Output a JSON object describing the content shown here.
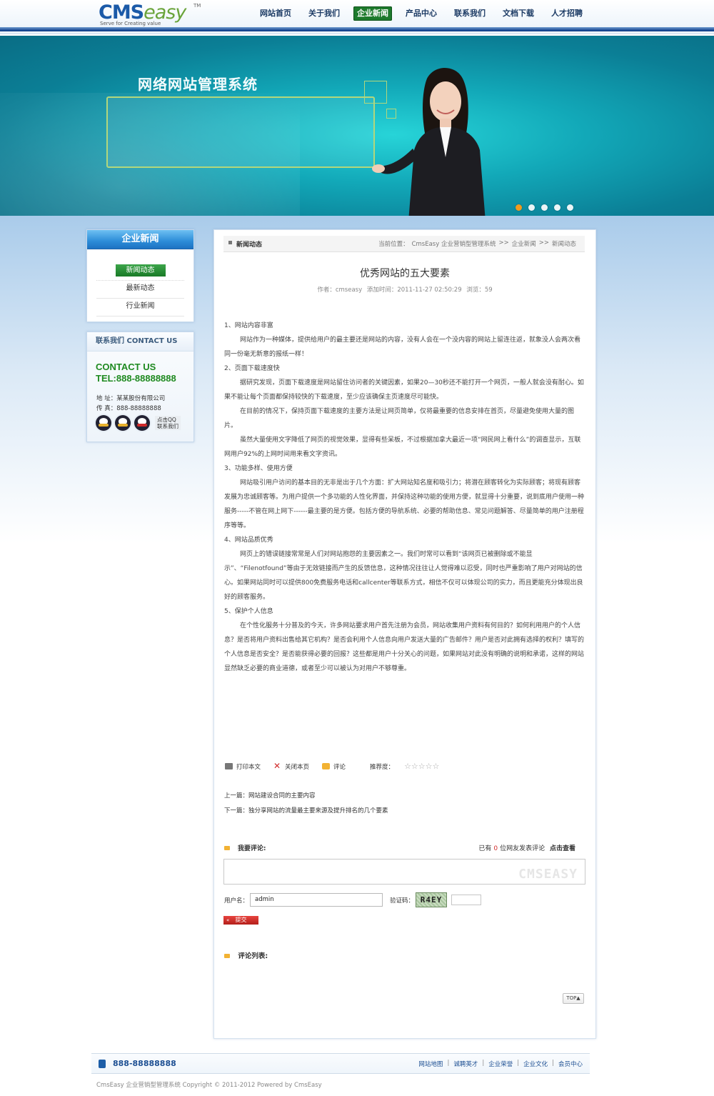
{
  "header": {
    "logo_main": "CMS",
    "logo_accent": "easy",
    "logo_tm": "TM",
    "slogan": "Serve for Creating value",
    "nav": [
      {
        "label": "网站首页"
      },
      {
        "label": "关于我们"
      },
      {
        "label": "企业新闻"
      },
      {
        "label": "产品中心"
      },
      {
        "label": "联系我们"
      },
      {
        "label": "文档下载"
      },
      {
        "label": "人才招聘"
      }
    ],
    "active_nav_index": 2
  },
  "banner": {
    "title": "网络网站管理系统",
    "slide_count": 5,
    "active_slide_index": 0
  },
  "sidebar": {
    "category_title": "企业新闻",
    "items": [
      {
        "label": "新闻动态"
      },
      {
        "label": "最新动态"
      },
      {
        "label": "行业新闻"
      }
    ],
    "contact": {
      "title": "联系我们 CONTACT US",
      "big_title": "CONTACT US",
      "tel": "TEL:888-88888888",
      "address": "地 址：某某股份有限公司",
      "fax": "传 真：888-88888888",
      "qq_text_1": "点击QQ",
      "qq_text_2": "联系我们"
    }
  },
  "main": {
    "section_title": "新闻动态",
    "breadcrumb": [
      "当前位置：",
      "CmsEasy 企业营销型管理系统",
      ">>",
      "企业新闻",
      ">>",
      "新闻动态"
    ],
    "article": {
      "title": "优秀网站的五大要素",
      "meta": {
        "author": "作者：cmseasy",
        "time": "添加时间：2011-11-27 02:50:29",
        "views": "浏览：59"
      },
      "paragraphs": [
        {
          "text": "1、网站内容非富",
          "indent": false
        },
        {
          "text": "网站作为一种媒体，提供给用户的最主要还是网站的内容，没有人会在一个没内容的网站上留连往返，就象没人会两次看同一份毫无新意的报纸一样！",
          "indent": true
        },
        {
          "text": "2、页面下载速度快",
          "indent": false
        },
        {
          "text": "据研究发现，页面下载速度是网站留住访问者的关键因素，如果20—30秒还不能打开一个网页，一般人就会没有耐心。如果不能让每个页面都保持较快的下载速度，至少应该确保主页速度尽可能快。",
          "indent": true
        },
        {
          "text": "在目前的情况下，保持页面下载速度的主要方法是让网页简单，仅将最重要的信息安排在首页，尽量避免使用大量的图片。",
          "indent": true
        },
        {
          "text": "虽然大量使用文字降低了网页的视觉效果，显得有些呆板，不过根据加拿大最近一项“网民网上看什么”的调查显示，互联网用户92%的上网时间用来看文字资讯。",
          "indent": true
        },
        {
          "text": "3、功能多样、使用方便",
          "indent": false
        },
        {
          "text": "网站吸引用户访问的基本目的无非是出于几个方面：扩大网站知名度和吸引力；将潜在顾客转化为实际顾客；将现有顾客发展为忠诚顾客等。为用户提供一个多功能的人性化界面，并保持这种功能的使用方便，就显得十分重要，说到底用户使用一种服务-----不管在网上网下------最主要的是方便。包括方便的导航系统、必要的帮助信息、常见问题解答、尽量简单的用户注册程序等等。",
          "indent": true
        },
        {
          "text": "4、网站品质优秀",
          "indent": false
        },
        {
          "text": "网页上的错误链接常常是人们对网站抱怨的主要因素之一。我们时常可以看到“该网页已被删除或不能显示”、“Filenotfound”等由于无效链接而产生的反馈信息，这种情况往往让人觉得难以忍受，同时也严重影响了用户对网站的信心。如果网站同时可以提供800免费服务电话和callcenter等联系方式，相信不仅可以体现公司的实力，而且更能充分体现出良好的顾客服务。",
          "indent": true
        },
        {
          "text": "5、保护个人信息",
          "indent": false
        },
        {
          "text": "在个性化服务十分普及的今天，许多网站要求用户首先注册为会员，网站收集用户资料有何目的？如何利用用户的个人信息？是否将用户资料出售给其它机构？是否会利用个人信息向用户发送大量的广告邮件？用户是否对此拥有选择的权利？填写的个人信息是否安全？是否能获得必要的回报？这些都是用户十分关心的问题，如果网站对此没有明确的说明和承诺，这样的网站显然缺乏必要的商业道德，或者至少可以被认为对用户不够尊重。",
          "indent": true
        }
      ]
    },
    "tools": {
      "print": "打印本文",
      "close": "关闭本页",
      "comment": "评论",
      "rating_label": "推荐度：",
      "rating_stars": "☆☆☆☆☆",
      "rating_value": 0,
      "rating_max": 5
    },
    "prev": "上一篇：网站建设合同的主要内容",
    "next": "下一篇：独分享网站的流量最主要来源及提升排名的几个要素",
    "comment": {
      "label": "我要评论:",
      "count_prefix": "已有",
      "count": "0",
      "count_suffix": "位网友发表评论",
      "view_link": "点击查看",
      "watermark": "CMSEASY",
      "username_label": "用户名：",
      "username_value": "admin",
      "captcha_label": "验证码：",
      "captcha_text": "R4EY",
      "submit": "提交"
    },
    "comment_list_title": "评论列表:",
    "top_button": "TOP▲"
  },
  "footer": {
    "phone": "888-88888888",
    "links": [
      "网站地图",
      "诚聘英才",
      "企业荣誉",
      "企业文化",
      "会员中心"
    ],
    "copyright": "CmsEasy 企业营销型管理系统  Copyright © 2011-2012  Powered by CmsEasy"
  }
}
